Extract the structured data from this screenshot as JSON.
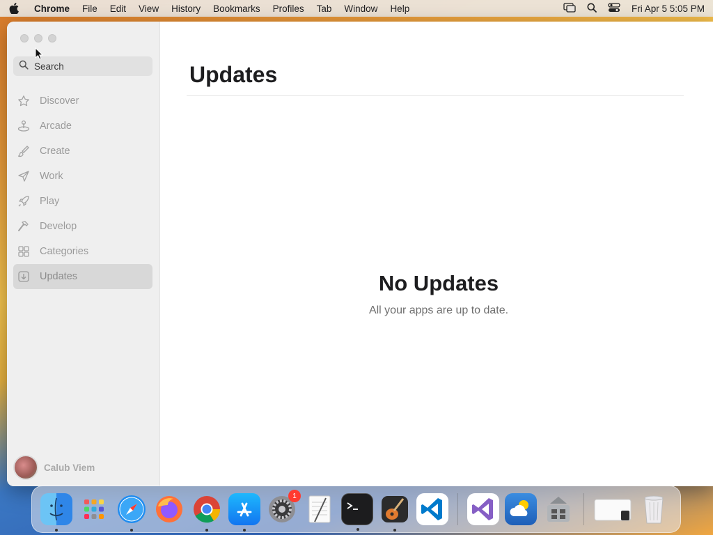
{
  "menubar": {
    "app_name": "Chrome",
    "items": [
      "File",
      "Edit",
      "View",
      "History",
      "Bookmarks",
      "Profiles",
      "Tab",
      "Window",
      "Help"
    ],
    "clock": "Fri Apr 5  5:05 PM"
  },
  "sidebar": {
    "search_placeholder": "Search",
    "items": [
      {
        "label": "Discover",
        "icon": "star-icon"
      },
      {
        "label": "Arcade",
        "icon": "joystick-icon"
      },
      {
        "label": "Create",
        "icon": "brush-icon"
      },
      {
        "label": "Work",
        "icon": "paper-plane-icon"
      },
      {
        "label": "Play",
        "icon": "rocket-icon"
      },
      {
        "label": "Develop",
        "icon": "hammer-icon"
      },
      {
        "label": "Categories",
        "icon": "grid-icon"
      },
      {
        "label": "Updates",
        "icon": "download-icon",
        "active": true
      }
    ],
    "user_name": "Calub Viem"
  },
  "main": {
    "title": "Updates",
    "empty_title": "No Updates",
    "empty_subtitle": "All your apps are up to date."
  },
  "dock": {
    "apps": [
      "Finder",
      "Launchpad",
      "Safari",
      "Firefox",
      "Chrome",
      "App Store",
      "System Settings",
      "TextEdit",
      "Terminal",
      "GarageBand",
      "Visual Studio Code",
      "Visual Studio",
      "Weather",
      "Boot Camp Assistant",
      "Preview",
      "Trash"
    ],
    "settings_badge": "1"
  }
}
